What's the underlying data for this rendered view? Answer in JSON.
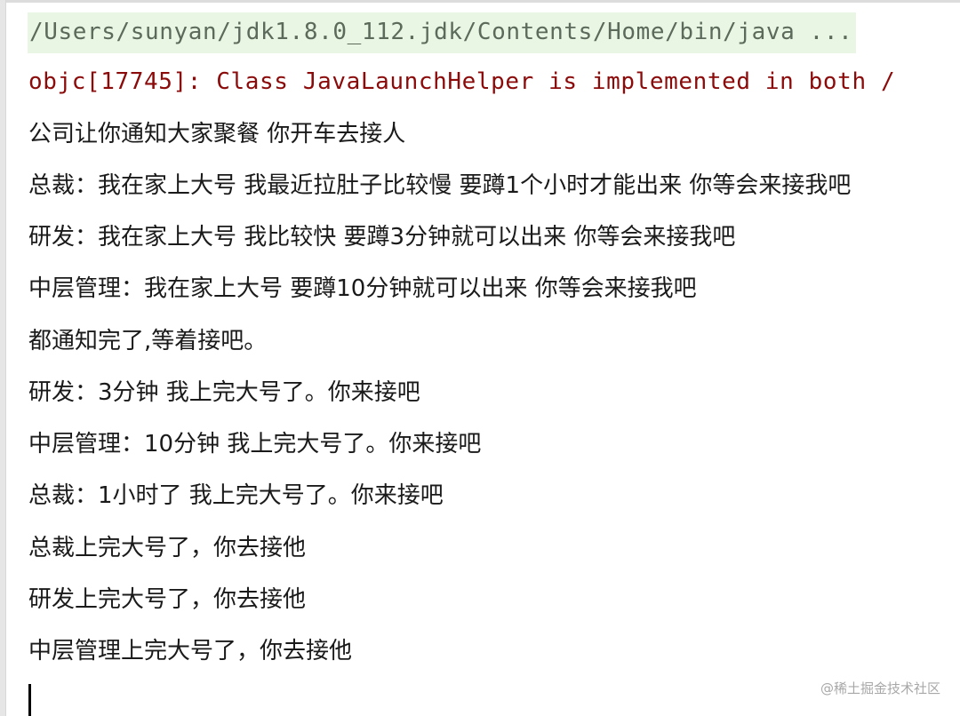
{
  "console": {
    "command_line": "/Users/sunyan/jdk1.8.0_112.jdk/Contents/Home/bin/java ...",
    "error_line": "objc[17745]: Class JavaLaunchHelper is implemented in both /",
    "output_lines": [
      "公司让你通知大家聚餐  你开车去接人",
      "总裁：我在家上大号  我最近拉肚子比较慢  要蹲1个小时才能出来  你等会来接我吧",
      "研发：我在家上大号  我比较快  要蹲3分钟就可以出来  你等会来接我吧",
      "中层管理：我在家上大号    要蹲10分钟就可以出来  你等会来接我吧",
      "都通知完了,等着接吧。",
      "研发：3分钟  我上完大号了。你来接吧",
      "中层管理：10分钟  我上完大号了。你来接吧",
      "总裁：1小时了  我上完大号了。你来接吧",
      "总裁上完大号了，你去接他",
      "研发上完大号了，你去接他",
      "中层管理上完大号了，你去接他"
    ]
  },
  "watermark": "@稀土掘金技术社区",
  "colors": {
    "command_bg": "#e9f6e4",
    "command_text": "#5b6a5b",
    "error_text": "#8b0a0a",
    "output_text": "#1a1a1a"
  }
}
